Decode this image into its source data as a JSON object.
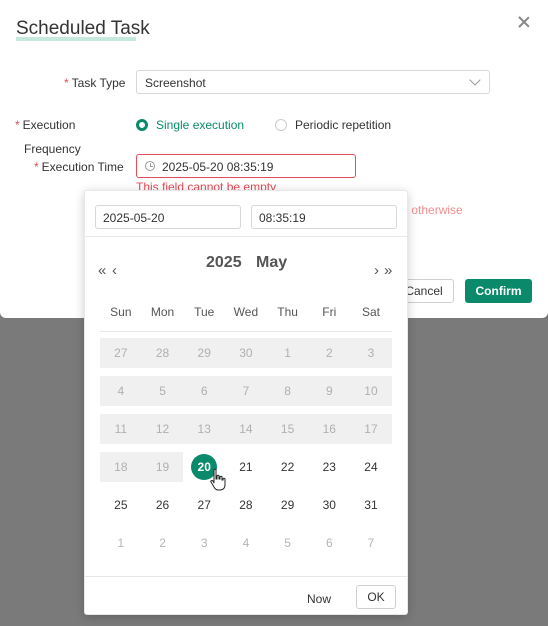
{
  "dialog": {
    "title": "Scheduled Task",
    "fields": {
      "task_type_label": "Task Type",
      "task_type_value": "Screenshot",
      "execution_label": "Execution",
      "frequency_label": "Frequency",
      "single_option": "Single execution",
      "periodic_option": "Periodic repetition",
      "execution_time_label": "Execution Time",
      "execution_time_value": "2025-05-20 08:35:19",
      "error_text": "This field cannot be empty",
      "hint_text": "e, otherwise"
    },
    "buttons": {
      "cancel": "Cancel",
      "confirm": "Confirm"
    }
  },
  "picker": {
    "date_value": "2025-05-20",
    "time_value": "08:35:19",
    "nav": {
      "prev_year": "«",
      "prev_month": "‹",
      "next_month": "›",
      "next_year": "»"
    },
    "year": "2025",
    "month": "May",
    "weekdays": [
      "Sun",
      "Mon",
      "Tue",
      "Wed",
      "Thu",
      "Fri",
      "Sat"
    ],
    "weeks": [
      [
        {
          "d": "27",
          "s": "dis"
        },
        {
          "d": "28",
          "s": "dis"
        },
        {
          "d": "29",
          "s": "dis"
        },
        {
          "d": "30",
          "s": "dis"
        },
        {
          "d": "1",
          "s": "dis"
        },
        {
          "d": "2",
          "s": "dis"
        },
        {
          "d": "3",
          "s": "dis"
        }
      ],
      [
        {
          "d": "4",
          "s": "dis"
        },
        {
          "d": "5",
          "s": "dis"
        },
        {
          "d": "6",
          "s": "dis"
        },
        {
          "d": "7",
          "s": "dis"
        },
        {
          "d": "8",
          "s": "dis"
        },
        {
          "d": "9",
          "s": "dis"
        },
        {
          "d": "10",
          "s": "dis"
        }
      ],
      [
        {
          "d": "11",
          "s": "dis"
        },
        {
          "d": "12",
          "s": "dis"
        },
        {
          "d": "13",
          "s": "dis"
        },
        {
          "d": "14",
          "s": "dis"
        },
        {
          "d": "15",
          "s": "dis"
        },
        {
          "d": "16",
          "s": "dis"
        },
        {
          "d": "17",
          "s": "dis"
        }
      ],
      [
        {
          "d": "18",
          "s": "dis"
        },
        {
          "d": "19",
          "s": "dis"
        },
        {
          "d": "20",
          "s": "sel"
        },
        {
          "d": "21",
          "s": ""
        },
        {
          "d": "22",
          "s": ""
        },
        {
          "d": "23",
          "s": ""
        },
        {
          "d": "24",
          "s": ""
        }
      ],
      [
        {
          "d": "25",
          "s": ""
        },
        {
          "d": "26",
          "s": ""
        },
        {
          "d": "27",
          "s": ""
        },
        {
          "d": "28",
          "s": ""
        },
        {
          "d": "29",
          "s": ""
        },
        {
          "d": "30",
          "s": ""
        },
        {
          "d": "31",
          "s": ""
        }
      ],
      [
        {
          "d": "1",
          "s": "out"
        },
        {
          "d": "2",
          "s": "out"
        },
        {
          "d": "3",
          "s": "out"
        },
        {
          "d": "4",
          "s": "out"
        },
        {
          "d": "5",
          "s": "out"
        },
        {
          "d": "6",
          "s": "out"
        },
        {
          "d": "7",
          "s": "out"
        }
      ]
    ],
    "now_label": "Now",
    "ok_label": "OK"
  },
  "colors": {
    "accent": "#0a8a6a",
    "error": "#e34d59",
    "disabled_bg": "#f0f0f0"
  }
}
